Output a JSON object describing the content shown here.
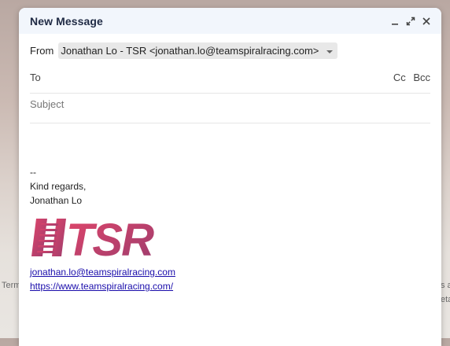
{
  "background": {
    "left_text": "Term",
    "right_text_1": "s a",
    "right_text_2": "eta"
  },
  "compose": {
    "title": "New Message",
    "from_label": "From",
    "from_value": "Jonathan Lo - TSR <jonathan.lo@teamspiralracing.com>",
    "to_label": "To",
    "cc_label": "Cc",
    "bcc_label": "Bcc",
    "subject_placeholder": "Subject"
  },
  "signature": {
    "separator": "--",
    "closing": "Kind regards,",
    "name": "Jonathan Lo",
    "logo_text": "TSR",
    "email": "jonathan.lo@teamspiralracing.com",
    "website": "https://www.teamspiralracing.com/"
  },
  "colors": {
    "header_bg": "#f2f6fc",
    "logo_gradient_start": "#e0456a",
    "logo_gradient_end": "#9c3d6e",
    "link": "#1a0dab"
  }
}
